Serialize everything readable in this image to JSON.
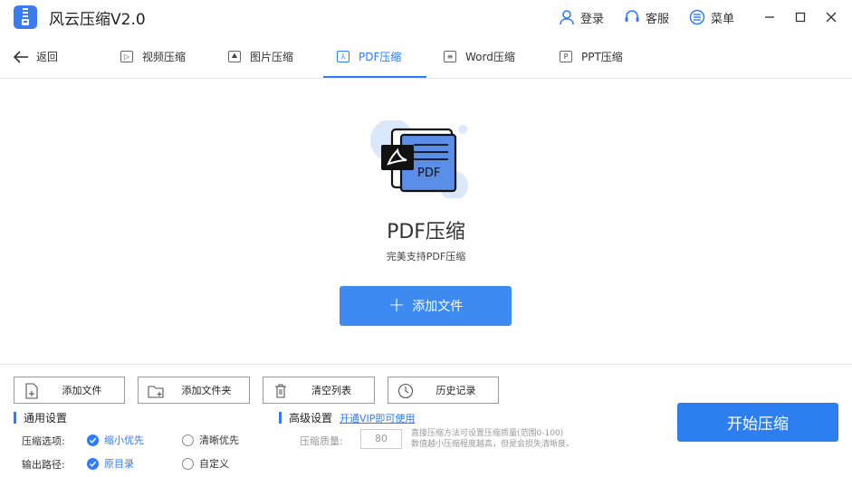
{
  "app": {
    "title": "风云压缩V2.0",
    "login_label": "登录",
    "service_label": "客服",
    "menu_label": "菜单"
  },
  "nav": {
    "back_label": "返回",
    "tabs": [
      {
        "label": "视频压缩",
        "icon": "video-icon"
      },
      {
        "label": "图片压缩",
        "icon": "image-icon"
      },
      {
        "label": "PDF压缩",
        "icon": "pdf-icon",
        "active": true
      },
      {
        "label": "Word压缩",
        "icon": "word-icon"
      },
      {
        "label": "PPT压缩",
        "icon": "ppt-icon"
      }
    ]
  },
  "hero": {
    "title": "PDF压缩",
    "subtitle": "完美支持PDF压缩",
    "add_button": "添加文件",
    "icon_text": "PDF"
  },
  "toolbar": {
    "add_file": "添加文件",
    "add_folder": "添加文件夹",
    "clear_list": "清空列表",
    "history": "历史记录"
  },
  "general": {
    "heading": "通用设置",
    "compress_option_label": "压缩选项:",
    "option_small": "缩小优先",
    "option_clear": "清晰优先",
    "output_label": "输出路径:",
    "output_original": "原目录",
    "output_custom": "自定义",
    "selected_option": "缩小优先",
    "selected_output": "原目录"
  },
  "advanced": {
    "heading": "高级设置",
    "vip_link": "开通VIP即可使用",
    "quality_label": "压缩质量:",
    "quality_value": "80",
    "desc_line1": "直接压缩方法可设置压缩质量(范围0-100)",
    "desc_line2": "数值越小压缩程度越高，但是会损失清晰度。"
  },
  "start_button": "开始压缩",
  "colors": {
    "accent": "#2e7bff",
    "button_blue": "#3d8bf0"
  }
}
